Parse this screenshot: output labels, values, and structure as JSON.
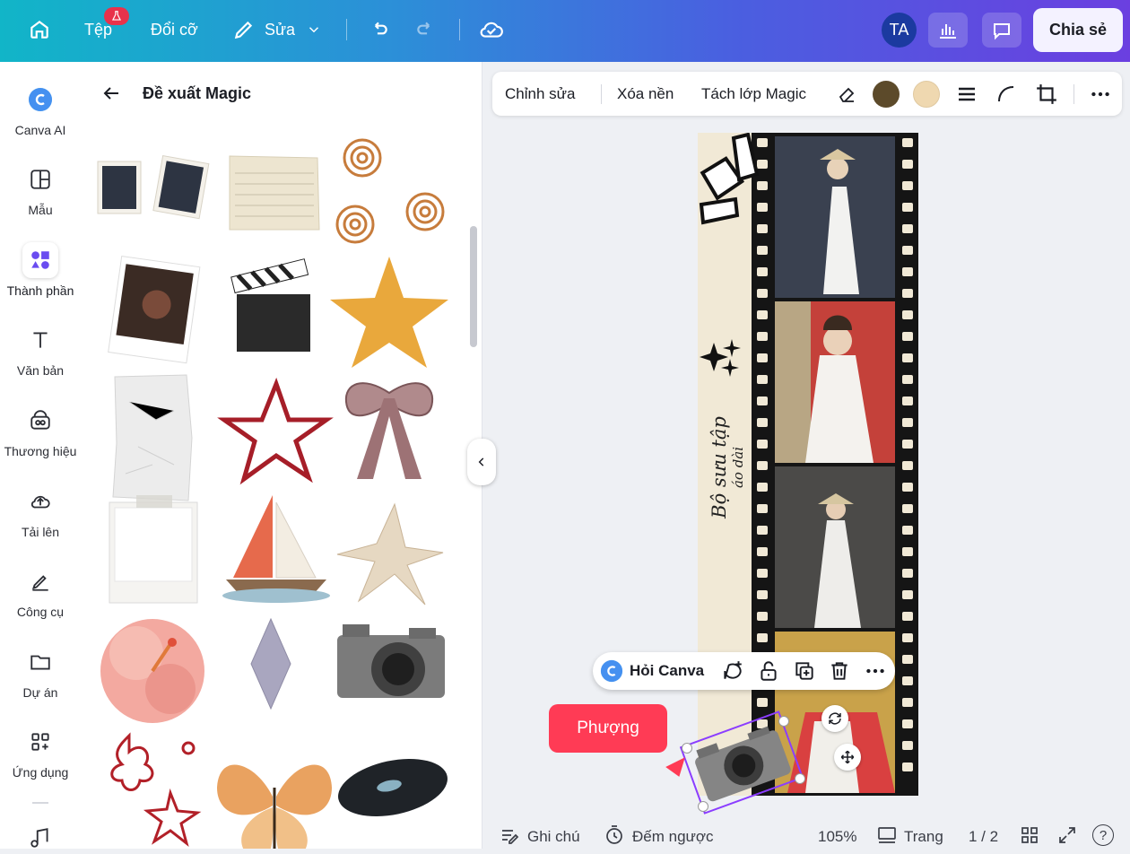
{
  "topbar": {
    "home_icon": "home-icon",
    "file_label": "Tệp",
    "resize_label": "Đổi cỡ",
    "edit_label": "Sửa",
    "avatar_initials": "TA",
    "share_label": "Chia sẻ"
  },
  "rail": {
    "items": [
      {
        "label": "Canva AI",
        "icon": "canva-ai-icon"
      },
      {
        "label": "Mẫu",
        "icon": "template-icon"
      },
      {
        "label": "Thành phần",
        "icon": "elements-icon"
      },
      {
        "label": "Văn bản",
        "icon": "text-icon"
      },
      {
        "label": "Thương hiệu",
        "icon": "brand-icon"
      },
      {
        "label": "Tải lên",
        "icon": "upload-icon"
      },
      {
        "label": "Công cụ",
        "icon": "tools-icon"
      },
      {
        "label": "Dự án",
        "icon": "folder-icon"
      },
      {
        "label": "Ứng dụng",
        "icon": "apps-icon"
      }
    ]
  },
  "panel": {
    "title": "Đề xuất Magic"
  },
  "context_toolbar": {
    "edit": "Chỉnh sửa",
    "remove_bg": "Xóa nền",
    "magic_layer": "Tách lớp Magic",
    "color1": "#5c4a2a",
    "color2": "#efd8b0"
  },
  "canvas": {
    "poster_title": "Bộ sưu tập",
    "poster_subtitle": "áo dài",
    "ask_canva": "Hỏi Canva",
    "collaborator_name": "Phượng"
  },
  "bottombar": {
    "notes": "Ghi chú",
    "timer": "Đếm ngược",
    "zoom": "105%",
    "pages_label": "Trang",
    "page_count": "1 / 2",
    "help": "?"
  }
}
